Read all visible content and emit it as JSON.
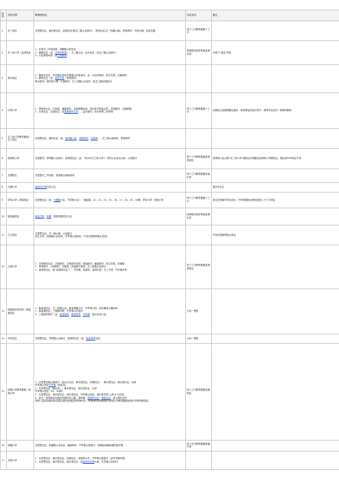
{
  "headers": {
    "no": "序号",
    "school": "学校名称",
    "area": "教育服务区",
    "middle": "对应初中",
    "note": "备注"
  },
  "rows": {
    "r1": {
      "no": "1",
      "a": "文一校区",
      "b": "长堂里社区、南长堂社区，景观社区(除文二路以北部分) ，西岸社区(文一西路以南)，府苑新村、市府大楼、百合花园",
      "mid": "杭十三中教育集团十三中"
    },
    "r2": {
      "no": "2",
      "school": "文一街小学",
      "campus": "高鸿校区",
      "p1": "1．长堂半二环线西段，湖墅路以西社区",
      "p2": "2．南都社区（含：",
      "link1": "世茂西西湖",
      "p2b": "），文二路以北，浙大社区（含北三路以北部分）",
      "p3": "3．小区旁各地块（含",
      "link2": "三坝新苑",
      "p3b": "）",
      "mid": "保俶塔实验学校紫金港中学",
      "note": "去掉了“德龙”学区"
    },
    "r3": {
      "no": "3",
      "campus": "秀水校区",
      "p1": "1．骆家庄社区、申花路沿线及丰潭路以东各地块，含：长浜村地块、钱江花苑、亿都地块",
      "p2": "2．翠苑社区（含：",
      "link": "紫金文苑",
      "p2b": "，翠苑新村），",
      "p3": "秀水新村、锦华苑公寓、九莲新村、文二西路以北地块（含文三路北侧部分）"
    },
    "r4": {
      "no": "4",
      "campus": "行知小学",
      "p1": "1．李家桥小区、行知苑、塘苗新村、沈家牌楼地块、杭州电子科技大学、花园新村、五福家园",
      "p2": "2．灯塔社区、文锦社区（含",
      "link": "金都城市芯宇",
      "p2b": "），益乐南村、杭州市第二体育场",
      "mid": "杭十三中教育集团十三中",
      "note": "近期应大范围调整后留存，按变更后的划分执行，原有学区划分一律视同废除"
    },
    "r5": {
      "no": "5",
      "school": "文三街小学教育集团",
      "campus": "文三校区",
      "p1": "长堂里社区、建设社区（含：",
      "link": "竞舟路小区",
      "p1b": "、",
      "link2": "求是新村",
      "p1c": "、",
      "link3": "文锦苑",
      "p1d": "），文三路以南地块，府苑新村"
    },
    "r6": {
      "no": "6",
      "campus": "嘉绿苑小学",
      "p1": "长堂里村、学院路以北部分，嘉绿苑社区（含：“杭州市文三街小学”）学校以北至北大街，以西部分",
      "mid": "杭十三中教育集团嘉绿苑校区",
      "note": "嘉绿苑小区从原“文三街小学”服务区内调整至嘉绿苑小学服务区，原区域ONE校区不变"
    },
    "r7": {
      "no": "7",
      "campus": "文理校区",
      "p1": "长堂里半二环线段，西溪路以南各地块",
      "mid": "杭十三中教育集团西溪中学"
    },
    "r8": {
      "no": "8",
      "campus": "文理小学",
      "link": "金地自在城",
      "p1b": "住宅小区",
      "note": "暂无毕业生"
    },
    "r9": {
      "no": "9",
      "school": "学军小学",
      "campus": "求智校区",
      "p1": "长堂里社区（含：",
      "link": "马塍路",
      "p1b": "小区、竹竿巷小区）、塘苗路、22、23、24、25、26、27、28、29、30幢，学军小学、西湖小学",
      "mid": "杭十三中教育集团十三中",
      "note": "其中古荡新村学区划片，竹竿巷路的北侧地段划入十三中学区"
    },
    "r10": {
      "no": "10",
      "campus": "紫金港校区",
      "link": "紫金文苑",
      "p1b": "、",
      "link2": "桃源",
      "p1c": "，银杏苑等住宅小区",
      "mid": "保俶塔实验学校紫金港中学"
    },
    "r11": {
      "no": "11",
      "campus": "之江校区",
      "p1": "长堂里社区、文一路以南、以西部分",
      "p1b": "浙江大学、西溪路以北地块，竹竿巷以西地区（不含中国美院象山校区）",
      "note": "不含中国美院象山校区"
    },
    "r12": {
      "no": "12",
      "campus": "九莲小学",
      "p1": "1．古荡新村社区、古荡新村、古荡新村东园，西溪新村，塘苗新村，钱江花苑，东塘苑",
      "p2": "2．府苑新村、九莲新村、华星苑，西溪路九莲苑，文三西路以北部分",
      "p3": "3．嘉绿苑社区（含“嘉绿苑社区”），竹竿巷，嘉绿苑，嘉绿东苑、文三东苑，竹竿巷东苑",
      "mid": "杭十三中教育集团嘉绿苑校区"
    },
    "r13": {
      "no": "13",
      "school": "保俶塔实验学校",
      "campus": "紫金港校区",
      "p1": "1．紫金港社区，文二西路以北，紫金港路以东，竹竿巷以西，余杭塘河以南地块",
      "p2": "2．紫金港社区，三墩镇华联，竹竿巷以东部分",
      "p3": "3．三墩镇华联村（含：",
      "link": "紫金港苑",
      "p3b": "、",
      "link2": "紫金花苑",
      "p3c": "、",
      "link3": "竹竿巷",
      "p3d": "，部分住宅小区）",
      "mid": "九年一贯制"
    },
    "r14": {
      "no": "14",
      "campus": "申花校区",
      "p1": "长堂里社区、学院路以北部分，嘉绿苑社区（含：",
      "link": "紫金港苑",
      "p1b": "社区）",
      "mid": "九年一贯制"
    },
    "r15": {
      "no": "15",
      "school": "西湖小学教育集团",
      "campus": "西湖小学",
      "p1": "1．长堂里北路以南部分（含北大社区、南长堂社区、西湖社区），南长堂社区，南长堂社区，北到",
      "p1b": "竹竿巷以西至",
      "link1": "竹竿巷",
      "p1c": "（南北向）",
      "p2": "2．长堂里社区（南北向），南长堂社区，南长堂社区，北到",
      "p2b": "竹竿巷以西至（61、62幢）",
      "p3": "3．长堂里社区，南长堂社区，南长堂社区，竹竿巷以西至，南长堂东苑“山外山”住宅区",
      "p4": "4．此外，西湖风景名胜区所属的北山路、葛岭路、",
      "link2": "栖霞岭社区",
      "p4b": "、",
      "link3": "满陇社区",
      "p4c": "，金沙港社区的",
      "p4d": "学龄儿童由西湖风景名胜区委托西湖区教育局代办，也按照同样原则划入西湖小学教育集团西湖小学教育服务区",
      "mid": "杭十三中教育集团西湖校区"
    },
    "r16": {
      "no": "16",
      "campus": "转塘小学",
      "p1": "长堂里社区、转塘路以北社区，塘苗新村、竹竿巷以西部分，西湖区转塘街道的各村落",
      "mid": "杭十五中教育集团转塘中学"
    },
    "r17": {
      "no": "17",
      "campus": "文新小学",
      "p1": "1．长堂里社区、南长堂社区、西湖社区，嘉绿苑以东，竹竿巷以南部分（含竹竿巷东苑）",
      "p2": "2．长堂里社区，南长堂社区，南长堂社区（含",
      "link": "金地自在城",
      "p2b": "以南，竹竿巷以北部分）"
    }
  }
}
